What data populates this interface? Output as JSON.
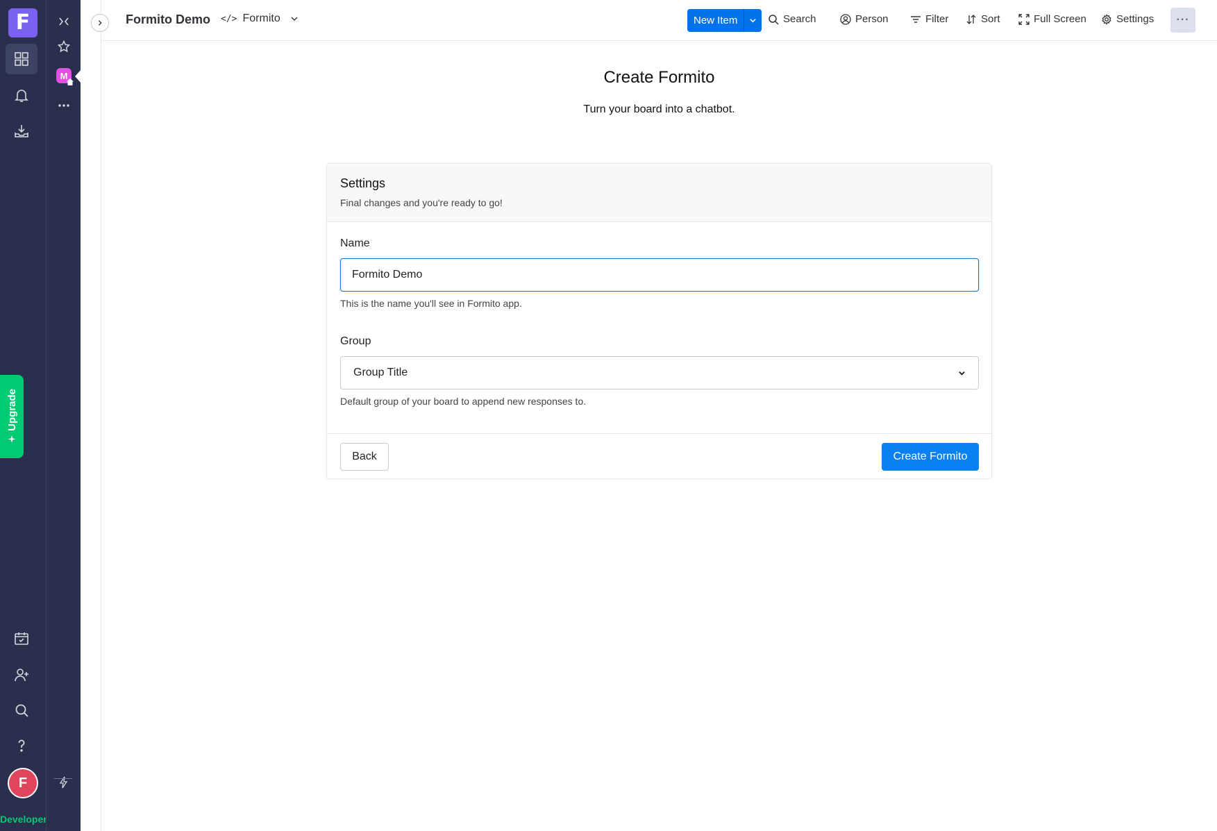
{
  "rail": {
    "logo_letter": "F",
    "upgrade_label": "Upgrade",
    "avatar_letter": "F",
    "plan_label": "Developer"
  },
  "panel": {
    "workspace_letter": "M"
  },
  "topbar": {
    "board_title": "Formito Demo",
    "view_label": "Formito",
    "view_icon": "</>",
    "new_item_label": "New Item",
    "search_label": "Search",
    "person_label": "Person",
    "filter_label": "Filter",
    "sort_label": "Sort",
    "fullscreen_label": "Full Screen",
    "settings_label": "Settings",
    "more_label": "···"
  },
  "page": {
    "title": "Create Formito",
    "subtitle": "Turn your board into a chatbot."
  },
  "card": {
    "title": "Settings",
    "subtitle": "Final changes and you're ready to go!",
    "name_label": "Name",
    "name_value": "Formito Demo",
    "name_help": "This is the name you'll see in Formito app.",
    "group_label": "Group",
    "group_value": "Group Title",
    "group_help": "Default group of your board to append new responses to.",
    "back_label": "Back",
    "create_label": "Create Formito"
  },
  "colors": {
    "rail_bg": "#292f4c",
    "primary": "#0073ea",
    "upgrade": "#00ca72",
    "logo": "#7b61f0",
    "avatar": "#e2445c",
    "workspace_badge": "#e44ee2"
  }
}
